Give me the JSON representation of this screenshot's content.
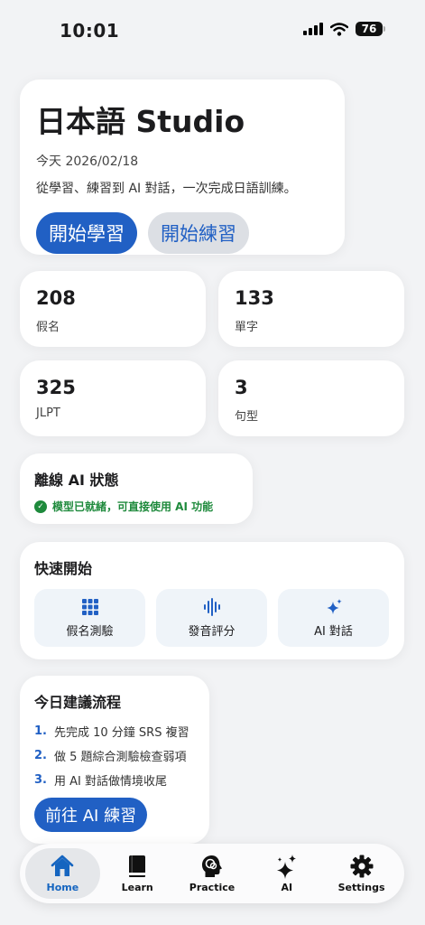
{
  "status_bar": {
    "time": "10:01",
    "battery": "76"
  },
  "hero": {
    "title": "日本語 Studio",
    "date": "今天 2026/02/18",
    "subtitle": "從學習、練習到 AI 對話，一次完成日語訓練。",
    "primary_button": "開始學習",
    "secondary_button": "開始練習"
  },
  "stats": [
    {
      "value": "208",
      "label": "假名"
    },
    {
      "value": "133",
      "label": "單字"
    },
    {
      "value": "325",
      "label": "JLPT"
    },
    {
      "value": "3",
      "label": "句型"
    }
  ],
  "offline_ai": {
    "title": "離線 AI 狀態",
    "status": "模型已就緒，可直接使用 AI 功能",
    "status_color": "#1e8a3c"
  },
  "quick_start": {
    "title": "快速開始",
    "items": [
      {
        "label": "假名測驗",
        "icon": "grid-icon"
      },
      {
        "label": "發音評分",
        "icon": "waveform-icon"
      },
      {
        "label": "AI 對話",
        "icon": "sparkles-icon"
      }
    ]
  },
  "daily_plan": {
    "title": "今日建議流程",
    "steps": [
      {
        "num": "1.",
        "text": "先完成 10 分鐘 SRS 複習"
      },
      {
        "num": "2.",
        "text": "做 5 題綜合測驗檢查弱項"
      },
      {
        "num": "3.",
        "text": "用 AI 對話做情境收尾"
      }
    ],
    "button": "前往 AI 練習"
  },
  "tabbar": {
    "tabs": [
      {
        "label": "Home",
        "icon": "house-icon",
        "active": true
      },
      {
        "label": "Learn",
        "icon": "book-icon",
        "active": false
      },
      {
        "label": "Practice",
        "icon": "brain-head-icon",
        "active": false
      },
      {
        "label": "AI",
        "icon": "sparkles-icon",
        "active": false
      },
      {
        "label": "Settings",
        "icon": "gear-icon",
        "active": false
      }
    ]
  },
  "colors": {
    "accent": "#2160c4",
    "background": "#f2f3f5",
    "success": "#1e8a3c"
  }
}
